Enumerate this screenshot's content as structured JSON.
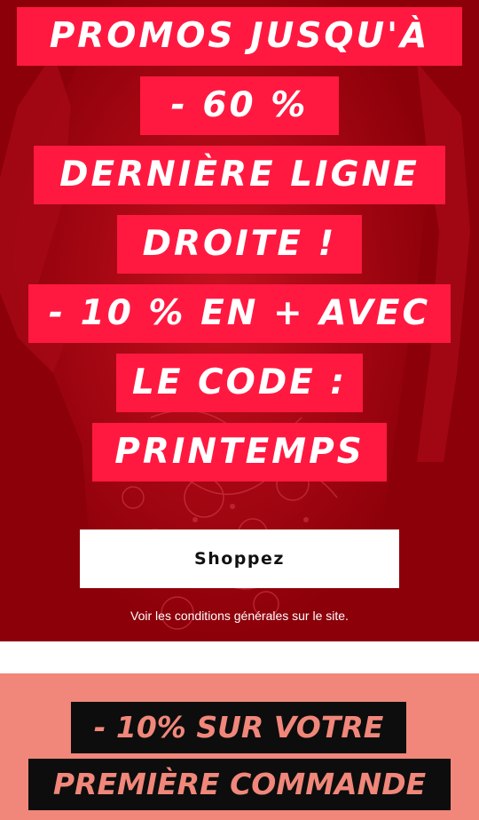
{
  "hero": {
    "headline": [
      "PROMOS JUSQU'À",
      "- 60 %",
      "DERNIÈRE LIGNE",
      "DROITE !",
      "- 10 % EN + AVEC",
      "LE CODE :",
      "PRINTEMPS"
    ],
    "cta_label": "Shoppez",
    "terms_text": "Voir les conditions générales sur le site."
  },
  "promo2": {
    "lines": [
      "- 10% SUR VOTRE",
      "PREMIÈRE COMMANDE"
    ]
  },
  "colors": {
    "hero_background": "#8c0009",
    "headline_box": "#ff1940",
    "headline_text": "#ffffff",
    "cta_background": "#ffffff",
    "cta_text": "#111111",
    "promo2_background": "#f0877a",
    "promo2_box": "#0d0d0d",
    "promo2_text": "#f0877a"
  }
}
